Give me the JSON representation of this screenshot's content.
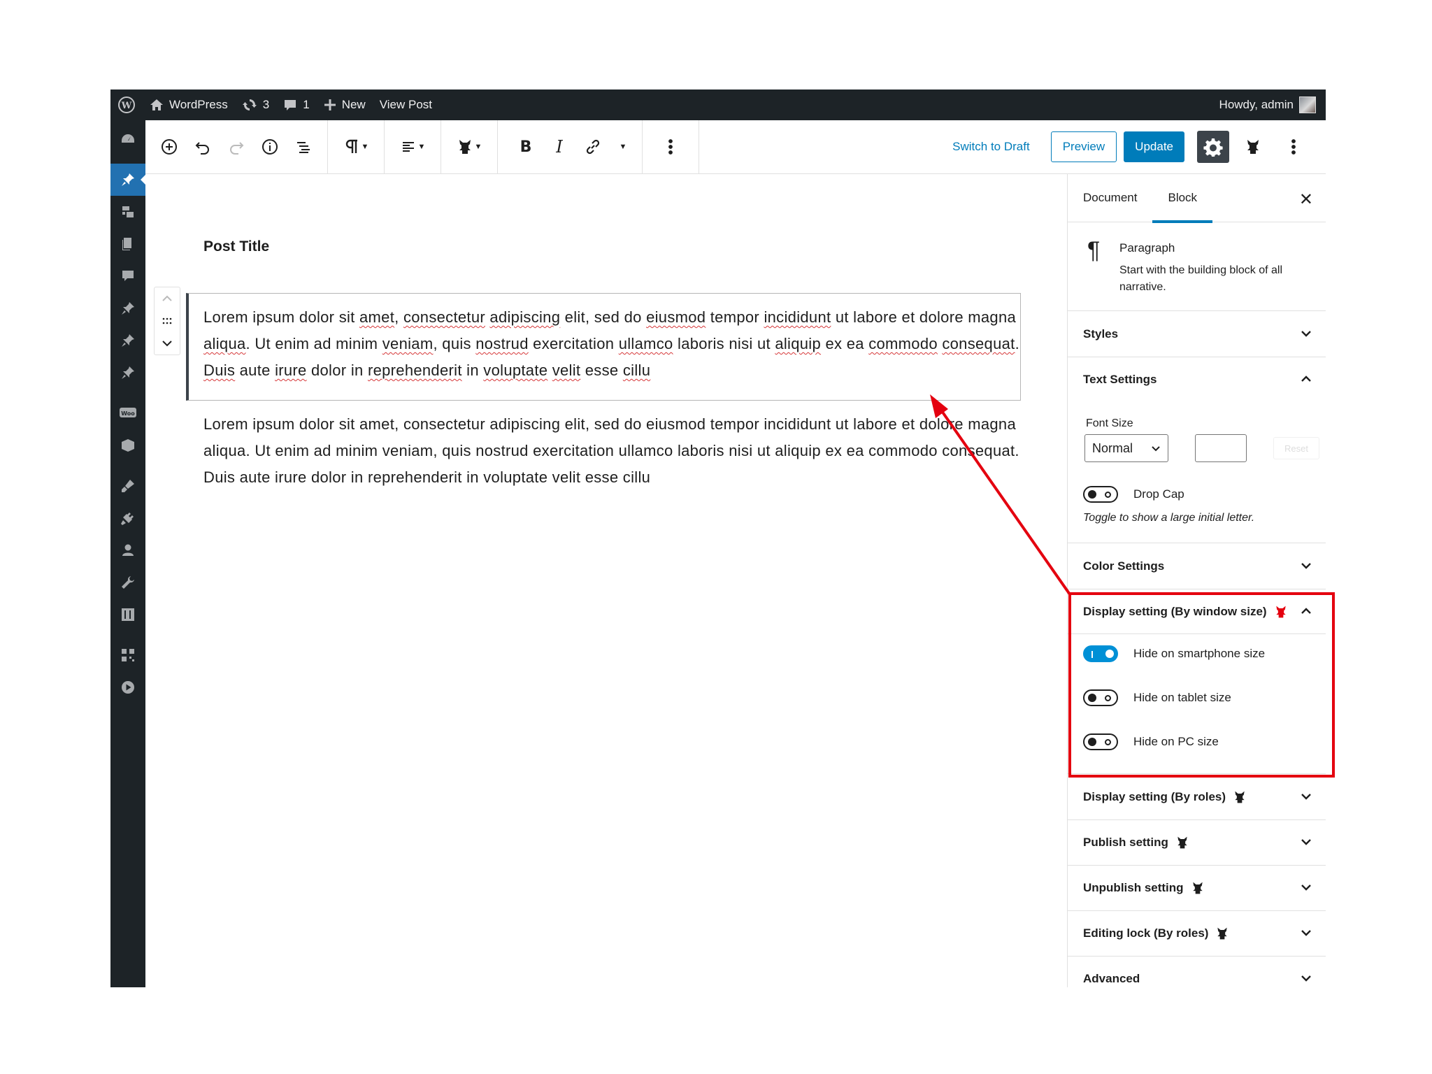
{
  "adminbar": {
    "site_name": "WordPress",
    "updates_count": "3",
    "comments_count": "1",
    "new_label": "New",
    "view_post_label": "View Post",
    "howdy": "Howdy, admin"
  },
  "toolbar": {
    "switch_to_draft": "Switch to Draft",
    "preview": "Preview",
    "update": "Update"
  },
  "editor": {
    "post_title": "Post Title",
    "paragraph": "Lorem ipsum dolor sit amet, consectetur adipiscing elit, sed do eiusmod tempor incididunt ut labore et dolore magna aliqua. Ut enim ad minim veniam, quis nostrud exercitation ullamco laboris nisi ut aliquip ex ea commodo consequat. Duis aute irure dolor in reprehenderit in voluptate velit esse cillu"
  },
  "sidebar": {
    "tabs": [
      "Document",
      "Block"
    ],
    "active_tab": "Block",
    "block": {
      "name": "Paragraph",
      "description": "Start with the building block of all narrative."
    },
    "panels": {
      "styles": "Styles",
      "text_settings": "Text Settings",
      "color_settings": "Color Settings",
      "display_window": "Display setting (By window size)",
      "display_roles": "Display setting (By roles)",
      "publish": "Publish setting",
      "unpublish": "Unpublish setting",
      "editing_lock": "Editing lock (By roles)",
      "advanced": "Advanced"
    },
    "text_settings": {
      "font_size_label": "Font Size",
      "font_size_value": "Normal",
      "reset_label": "Reset",
      "drop_cap_label": "Drop Cap",
      "drop_cap_help": "Toggle to show a large initial letter."
    },
    "display_window": {
      "smartphone": {
        "label": "Hide on smartphone size",
        "on": true
      },
      "tablet": {
        "label": "Hide on tablet size",
        "on": false
      },
      "pc": {
        "label": "Hide on PC size",
        "on": false
      }
    }
  },
  "colors": {
    "admin_bar": "#1d2327",
    "primary": "#007cba",
    "annotation": "#e4000f"
  }
}
